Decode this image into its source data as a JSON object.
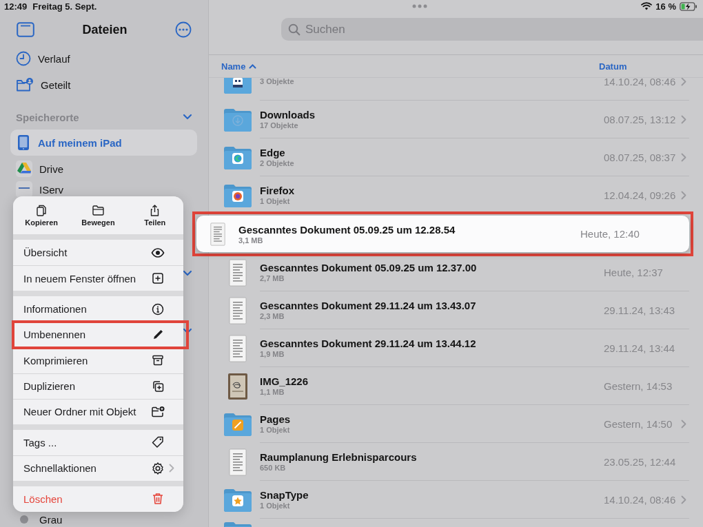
{
  "status_bar": {
    "time": "12:49",
    "date": "Freitag 5. Sept.",
    "battery": "16 %"
  },
  "sidebar": {
    "title": "Dateien",
    "items": [
      {
        "label": "Verlauf",
        "selected": false
      },
      {
        "label": "Geteilt",
        "selected": false
      }
    ],
    "sections": [
      {
        "title": "Speicherorte",
        "expanded": true,
        "items": [
          {
            "label": "Auf meinem iPad",
            "selected": true
          },
          {
            "label": "Drive",
            "selected": false
          },
          {
            "label": "IServ",
            "selected": false
          }
        ]
      },
      {
        "expanded": true
      },
      {
        "expanded": true,
        "items": [
          {
            "label": "Grau",
            "selected": false,
            "color": "#8e8e93"
          }
        ]
      }
    ]
  },
  "search": {
    "placeholder": "Suchen"
  },
  "columns": [
    {
      "label": "Name",
      "sorted": true
    },
    {
      "label": "Datum",
      "sorted": false
    }
  ],
  "files": [
    {
      "kind": "folder",
      "detail": "3 Objekte",
      "date": "14.10.24, 08:46",
      "lifted": false,
      "annotated": false
    },
    {
      "kind": "folder",
      "name": "Downloads",
      "detail": "17 Objekte",
      "date": "08.07.25, 13:12",
      "lifted": false,
      "annotated": false
    },
    {
      "kind": "folder",
      "name": "Edge",
      "detail": "2 Objekte",
      "date": "08.07.25, 08:37",
      "lifted": false,
      "annotated": false
    },
    {
      "kind": "folder",
      "name": "Firefox",
      "detail": "1 Objekt",
      "date": "12.04.24, 09:26",
      "lifted": false,
      "annotated": false
    },
    {
      "kind": "document",
      "name": "Gescanntes Dokument 05.09.25 um 12.28.54",
      "detail": "3,1 MB",
      "date": "Heute, 12:40",
      "lifted": true,
      "annotated": true
    },
    {
      "kind": "document",
      "name": "Gescanntes Dokument 05.09.25 um 12.37.00",
      "detail": "2,7 MB",
      "date": "Heute, 12:37",
      "lifted": false,
      "annotated": false
    },
    {
      "kind": "document",
      "name": "Gescanntes Dokument 29.11.24 um 13.43.07",
      "detail": "2,3 MB",
      "date": "29.11.24, 13:43",
      "lifted": false,
      "annotated": false
    },
    {
      "kind": "document",
      "name": "Gescanntes Dokument 29.11.24 um 13.44.12",
      "detail": "1,9 MB",
      "date": "29.11.24, 13:44",
      "lifted": false,
      "annotated": false
    },
    {
      "kind": "photo",
      "name": "IMG_1226",
      "detail": "1,1 MB",
      "date": "Gestern, 14:53",
      "lifted": false,
      "annotated": false
    },
    {
      "kind": "folder",
      "name": "Pages",
      "detail": "1 Objekt",
      "date": "Gestern, 14:50",
      "lifted": false,
      "annotated": false
    },
    {
      "kind": "document",
      "name": "Raumplanung Erlebnisparcours",
      "detail": "650 KB",
      "date": "23.05.25, 12:44",
      "lifted": false,
      "annotated": false
    },
    {
      "kind": "folder",
      "name": "SnapType",
      "detail": "1 Objekt",
      "date": "14.10.24, 08:46",
      "lifted": false,
      "annotated": false
    },
    {
      "kind": "folder",
      "lifted": false,
      "annotated": false
    }
  ],
  "menu": {
    "actions": [
      {
        "label": "Kopieren"
      },
      {
        "label": "Bewegen"
      },
      {
        "label": "Teilen"
      }
    ],
    "groups": [
      {
        "items": [
          {
            "label": "Übersicht",
            "destructive": false,
            "submenu": false,
            "annotated": false
          },
          {
            "label": "In neuem Fenster öffnen",
            "destructive": false,
            "submenu": false,
            "annotated": false
          }
        ]
      },
      {
        "items": [
          {
            "label": "Informationen",
            "destructive": false,
            "submenu": false,
            "annotated": false
          },
          {
            "label": "Umbenennen",
            "destructive": false,
            "submenu": false,
            "annotated": true
          },
          {
            "label": "Komprimieren",
            "destructive": false,
            "submenu": false,
            "annotated": false
          },
          {
            "label": "Duplizieren",
            "destructive": false,
            "submenu": false,
            "annotated": false
          },
          {
            "label": "Neuer Ordner mit Objekt",
            "destructive": false,
            "submenu": false,
            "annotated": false
          }
        ]
      },
      {
        "items": [
          {
            "label": "Tags ...",
            "destructive": false,
            "submenu": false,
            "annotated": false
          },
          {
            "label": "Schnellaktionen",
            "destructive": false,
            "submenu": true,
            "annotated": false
          }
        ]
      },
      {
        "items": [
          {
            "label": "Löschen",
            "destructive": true,
            "submenu": false,
            "annotated": false
          }
        ]
      }
    ]
  }
}
